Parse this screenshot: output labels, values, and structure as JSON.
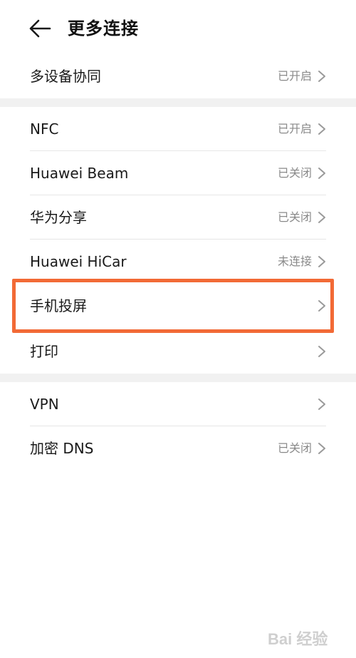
{
  "header": {
    "title": "更多连接",
    "back_icon": "back-arrow-icon"
  },
  "group1": [
    {
      "label": "多设备协同",
      "value": "已开启"
    }
  ],
  "group2": [
    {
      "label": "NFC",
      "value": "已开启"
    },
    {
      "label": "Huawei Beam",
      "value": "已关闭"
    },
    {
      "label": "华为分享",
      "value": "已关闭"
    },
    {
      "label": "Huawei HiCar",
      "value": "未连接"
    },
    {
      "label": "手机投屏",
      "value": ""
    },
    {
      "label": "打印",
      "value": ""
    }
  ],
  "group3": [
    {
      "label": "VPN",
      "value": ""
    },
    {
      "label": "加密 DNS",
      "value": "已关闭"
    }
  ],
  "colors": {
    "highlight": "#f26a36",
    "section_gap": "#f1f1f1",
    "secondary_text": "#8a8a8a"
  },
  "watermark": {
    "text": "Bai 经验"
  }
}
